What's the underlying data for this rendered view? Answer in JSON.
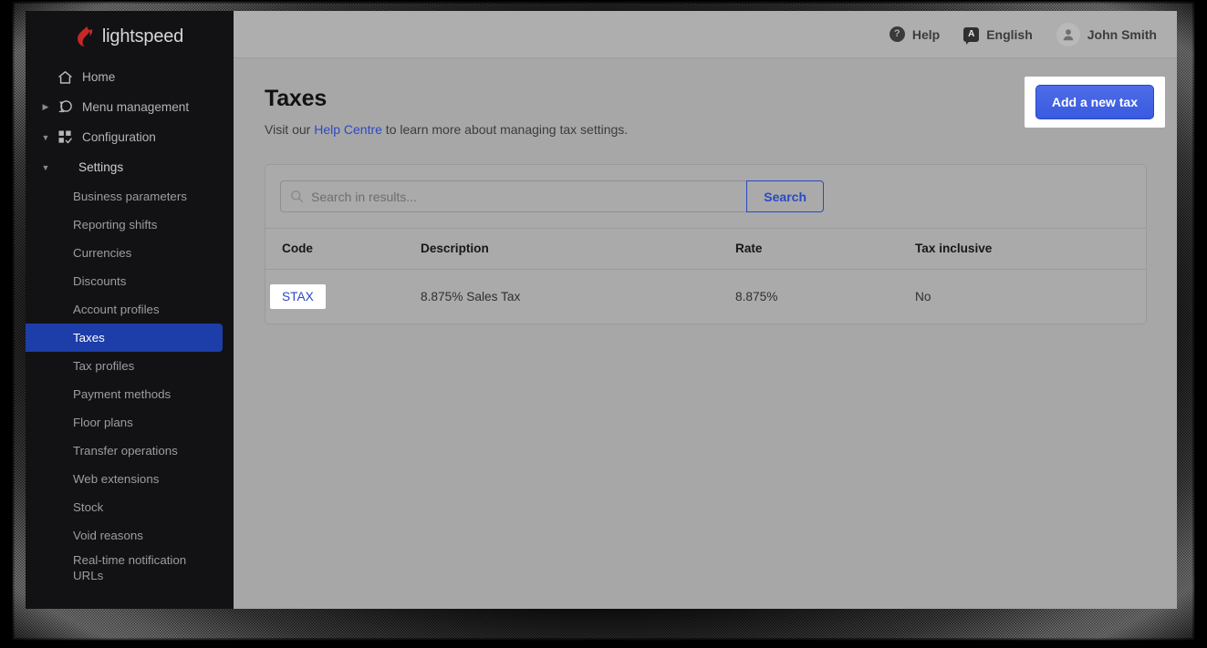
{
  "brand": {
    "logo_text": "lightspeed",
    "logo_icon": "flame-icon",
    "logo_color": "#c62828"
  },
  "sidebar": {
    "items": [
      {
        "label": "Home",
        "icon": "home-icon",
        "level": 1,
        "caret": null,
        "active": false
      },
      {
        "label": "Menu management",
        "icon": "menu-management-icon",
        "level": 1,
        "caret": "collapsed",
        "active": false
      },
      {
        "label": "Configuration",
        "icon": "configuration-icon",
        "level": 1,
        "caret": "expanded",
        "active": false
      }
    ],
    "settings_group": {
      "label": "Settings",
      "caret": "expanded"
    },
    "settings_items": [
      {
        "label": "Business parameters",
        "active": false
      },
      {
        "label": "Reporting shifts",
        "active": false
      },
      {
        "label": "Currencies",
        "active": false
      },
      {
        "label": "Discounts",
        "active": false
      },
      {
        "label": "Account profiles",
        "active": false
      },
      {
        "label": "Taxes",
        "active": true
      },
      {
        "label": "Tax profiles",
        "active": false
      },
      {
        "label": "Payment methods",
        "active": false
      },
      {
        "label": "Floor plans",
        "active": false
      },
      {
        "label": "Transfer operations",
        "active": false
      },
      {
        "label": "Web extensions",
        "active": false
      },
      {
        "label": "Stock",
        "active": false
      },
      {
        "label": "Void reasons",
        "active": false
      },
      {
        "label": "Real-time notification URLs",
        "active": false
      }
    ],
    "active_bg": "#1d3da8"
  },
  "topbar": {
    "help": {
      "label": "Help",
      "icon": "question-circle-icon",
      "glyph": "?"
    },
    "language": {
      "label": "English",
      "icon": "language-icon",
      "glyph": "A"
    },
    "user": {
      "name": "John Smith",
      "icon": "avatar-icon"
    }
  },
  "page": {
    "title": "Taxes",
    "subtitle_before": "Visit our ",
    "subtitle_link": "Help Centre",
    "subtitle_after": " to learn more about managing tax settings.",
    "link_color": "#2b49c4"
  },
  "actions": {
    "add_tax_label": "Add a new tax",
    "add_tax_color": "#3f60e4",
    "highlighted": true
  },
  "search": {
    "placeholder": "Search in results...",
    "value": "",
    "button_label": "Search",
    "icon": "search-icon"
  },
  "table": {
    "columns": [
      "Code",
      "Description",
      "Rate",
      "Tax inclusive"
    ],
    "rows": [
      {
        "code": "STAX",
        "code_highlighted": true,
        "description": "8.875% Sales Tax",
        "rate": "8.875%",
        "tax_inclusive": "No"
      }
    ]
  }
}
